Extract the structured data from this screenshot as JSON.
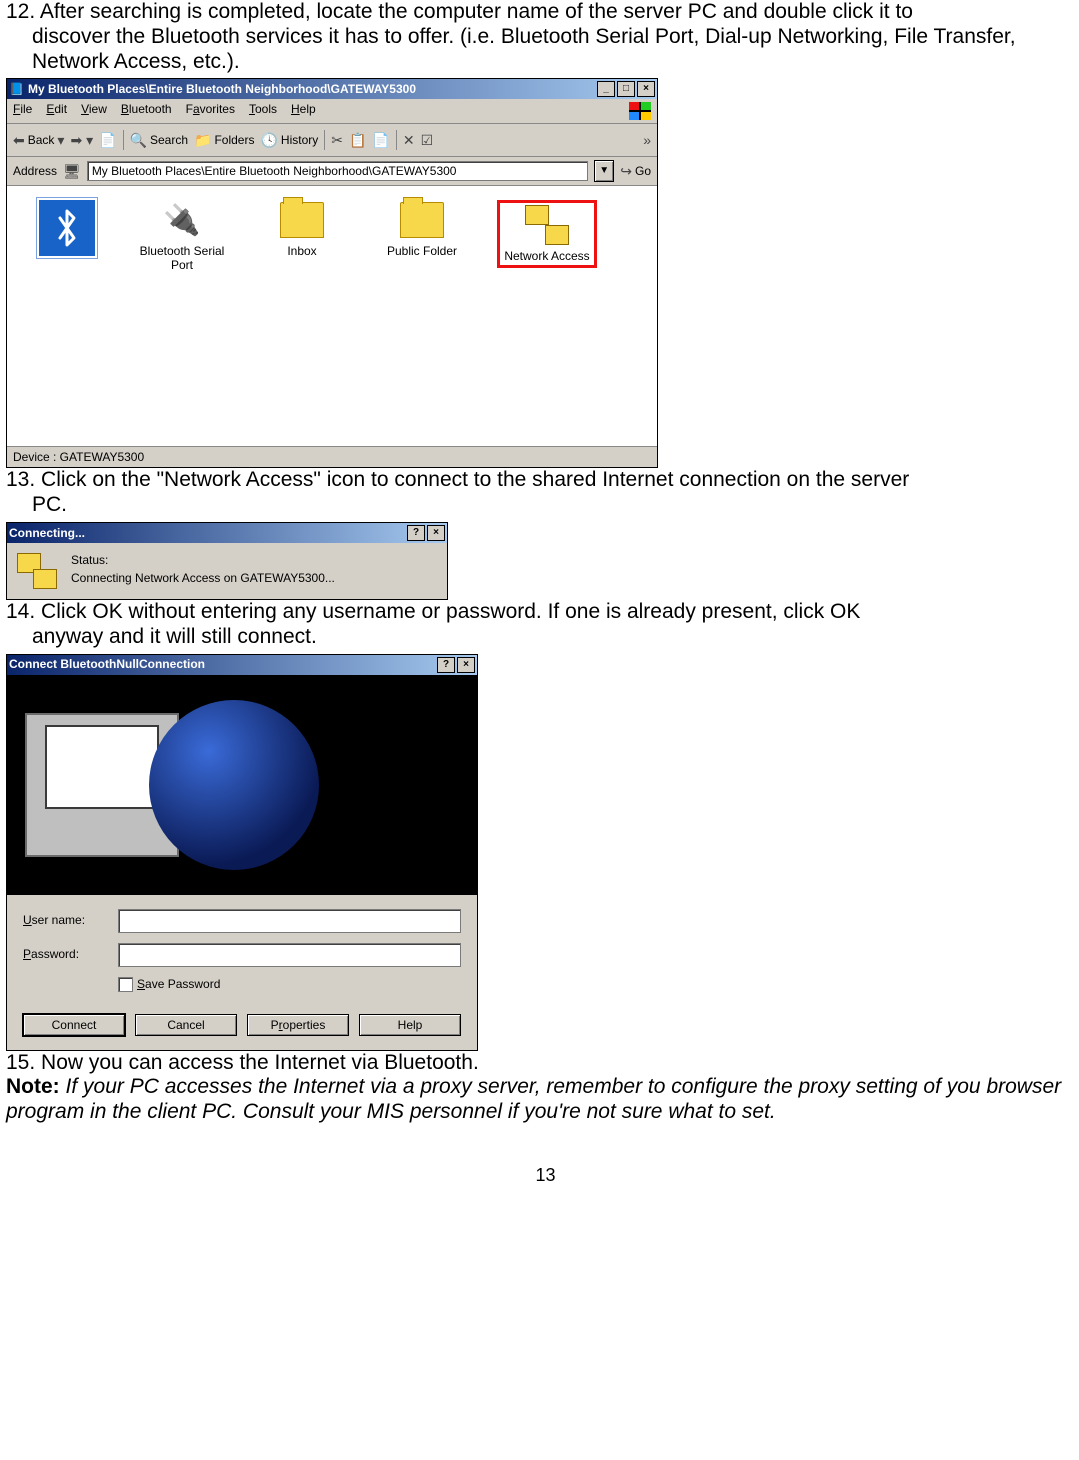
{
  "steps": {
    "s12": "12. After searching is completed, locate the computer name of the server PC and double click it to",
    "s12b": "discover the Bluetooth services it has to offer. (i.e. Bluetooth Serial Port, Dial-up Networking, File Transfer, Network Access, etc.).",
    "s13": "13. Click on the \"Network Access\" icon to connect to the shared Internet connection on the server",
    "s13b": "PC.",
    "s14": "14. Click OK without entering any username or password. If one is already present, click OK",
    "s14b": "anyway and it will still connect.",
    "s15": "15. Now you can access the Internet via Bluetooth."
  },
  "note": {
    "label": "Note:",
    "body": " If your PC accesses the Internet via a proxy server, remember to configure the proxy setting of you browser program in the client PC. Consult your MIS personnel if you're not sure what to set."
  },
  "pagenum": "13",
  "explorer": {
    "title": "My Bluetooth Places\\Entire Bluetooth Neighborhood\\GATEWAY5300",
    "menus": [
      "File",
      "Edit",
      "View",
      "Bluetooth",
      "Favorites",
      "Tools",
      "Help"
    ],
    "tb": {
      "back": "Back",
      "search": "Search",
      "folders": "Folders",
      "history": "History"
    },
    "addr_label": "Address",
    "addr_value": "My Bluetooth Places\\Entire Bluetooth Neighborhood\\GATEWAY5300",
    "go": "Go",
    "icons": {
      "serial": "Bluetooth Serial Port",
      "inbox": "Inbox",
      "public": "Public Folder",
      "net": "Network Access"
    },
    "status": "Device : GATEWAY5300"
  },
  "connecting": {
    "title": "Connecting...",
    "status_label": "Status:",
    "status_text": "Connecting Network Access on GATEWAY5300..."
  },
  "dial": {
    "title": "Connect BluetoothNullConnection",
    "user": "User name:",
    "pass": "Password:",
    "save": "Save Password",
    "connect": "Connect",
    "cancel": "Cancel",
    "props": "Properties",
    "help": "Help"
  }
}
